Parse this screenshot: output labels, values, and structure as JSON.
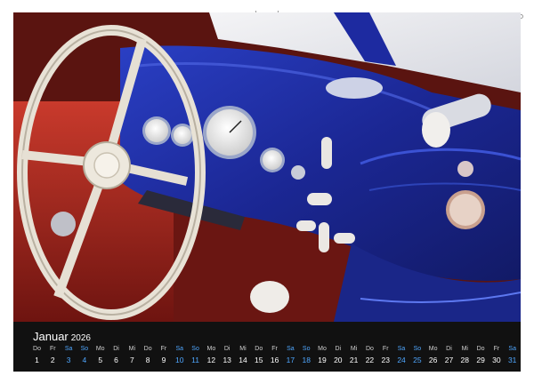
{
  "calendar": {
    "month": "Januar",
    "year": "2026",
    "days": [
      {
        "dn": "Do",
        "num": "1",
        "we": false
      },
      {
        "dn": "Fr",
        "num": "2",
        "we": false
      },
      {
        "dn": "Sa",
        "num": "3",
        "we": true
      },
      {
        "dn": "So",
        "num": "4",
        "we": true
      },
      {
        "dn": "Mo",
        "num": "5",
        "we": false
      },
      {
        "dn": "Di",
        "num": "6",
        "we": false
      },
      {
        "dn": "Mi",
        "num": "7",
        "we": false
      },
      {
        "dn": "Do",
        "num": "8",
        "we": false
      },
      {
        "dn": "Fr",
        "num": "9",
        "we": false
      },
      {
        "dn": "Sa",
        "num": "10",
        "we": true
      },
      {
        "dn": "So",
        "num": "11",
        "we": true
      },
      {
        "dn": "Mo",
        "num": "12",
        "we": false
      },
      {
        "dn": "Di",
        "num": "13",
        "we": false
      },
      {
        "dn": "Mi",
        "num": "14",
        "we": false
      },
      {
        "dn": "Do",
        "num": "15",
        "we": false
      },
      {
        "dn": "Fr",
        "num": "16",
        "we": false
      },
      {
        "dn": "Sa",
        "num": "17",
        "we": true
      },
      {
        "dn": "So",
        "num": "18",
        "we": true
      },
      {
        "dn": "Mo",
        "num": "19",
        "we": false
      },
      {
        "dn": "Di",
        "num": "20",
        "we": false
      },
      {
        "dn": "Mi",
        "num": "21",
        "we": false
      },
      {
        "dn": "Do",
        "num": "22",
        "we": false
      },
      {
        "dn": "Fr",
        "num": "23",
        "we": false
      },
      {
        "dn": "Sa",
        "num": "24",
        "we": true
      },
      {
        "dn": "So",
        "num": "25",
        "we": true
      },
      {
        "dn": "Mo",
        "num": "26",
        "we": false
      },
      {
        "dn": "Di",
        "num": "27",
        "we": false
      },
      {
        "dn": "Mi",
        "num": "28",
        "we": false
      },
      {
        "dn": "Do",
        "num": "29",
        "we": false
      },
      {
        "dn": "Fr",
        "num": "30",
        "we": false
      },
      {
        "dn": "Sa",
        "num": "31",
        "we": true
      }
    ]
  },
  "colors": {
    "dashboard_blue": "#1c2a9a",
    "upholstery_red": "#b0281f",
    "steering_cream": "#e8e2d6",
    "calendar_bg": "#111111",
    "weekend_blue": "#4fa7ff"
  }
}
